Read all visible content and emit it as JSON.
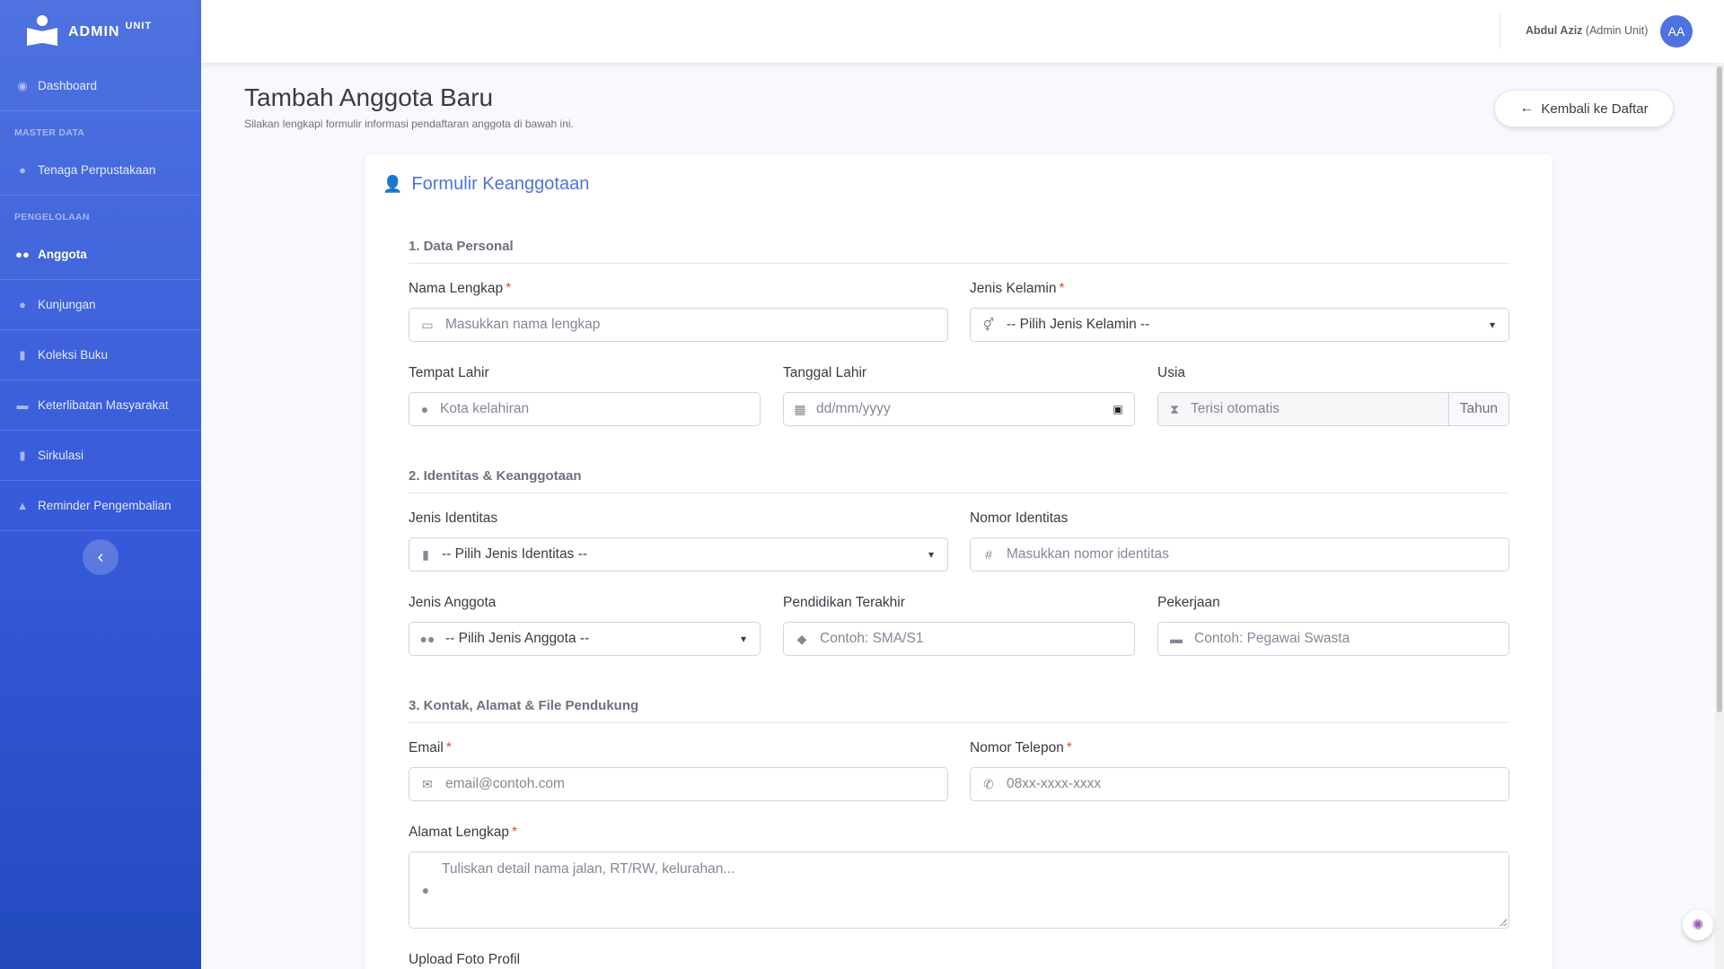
{
  "brand": {
    "name": "ADMIN",
    "suffix": "UNIT"
  },
  "sidebar": {
    "items": [
      {
        "label": "Dashboard",
        "icon": "dashboard-icon"
      },
      {
        "heading": "MASTER DATA"
      },
      {
        "label": "Tenaga Perpustakaan",
        "icon": "user-icon"
      },
      {
        "heading": "PENGELOLAAN"
      },
      {
        "label": "Anggota",
        "icon": "users-icon",
        "active": true
      },
      {
        "label": "Kunjungan",
        "icon": "user-walk-icon"
      },
      {
        "label": "Koleksi Buku",
        "icon": "book-icon"
      },
      {
        "label": "Keterlibatan Masyarakat",
        "icon": "handshake-icon"
      },
      {
        "label": "Sirkulasi",
        "icon": "clipboard-icon"
      },
      {
        "label": "Reminder Pengembalian",
        "icon": "bell-icon"
      }
    ],
    "collapse_icon": "chevron-left-icon"
  },
  "topbar": {
    "user_name": "Abdul Aziz",
    "user_role": "(Admin Unit)",
    "avatar_initials": "AA"
  },
  "header": {
    "title": "Tambah Anggota Baru",
    "subtitle": "Silakan lengkapi formulir informasi pendaftaran anggota di bawah ini.",
    "back_label": "Kembali ke Daftar"
  },
  "form": {
    "title": "Formulir Keanggotaan",
    "sections": {
      "personal": "1. Data Personal",
      "identity": "2. Identitas & Keanggotaan",
      "contact": "3. Kontak, Alamat & File Pendukung"
    },
    "fields": {
      "nama_lengkap": {
        "label": "Nama Lengkap",
        "placeholder": "Masukkan nama lengkap"
      },
      "jenis_kelamin": {
        "label": "Jenis Kelamin",
        "value": "-- Pilih Jenis Kelamin --"
      },
      "tempat_lahir": {
        "label": "Tempat Lahir",
        "placeholder": "Kota kelahiran"
      },
      "tanggal_lahir": {
        "label": "Tanggal Lahir",
        "placeholder": "dd/mm/yyyy"
      },
      "usia": {
        "label": "Usia",
        "placeholder": "Terisi otomatis",
        "suffix": "Tahun"
      },
      "jenis_identitas": {
        "label": "Jenis Identitas",
        "value": "-- Pilih Jenis Identitas --"
      },
      "nomor_identitas": {
        "label": "Nomor Identitas",
        "placeholder": "Masukkan nomor identitas"
      },
      "jenis_anggota": {
        "label": "Jenis Anggota",
        "value": "-- Pilih Jenis Anggota --"
      },
      "pendidikan": {
        "label": "Pendidikan Terakhir",
        "placeholder": "Contoh: SMA/S1"
      },
      "pekerjaan": {
        "label": "Pekerjaan",
        "placeholder": "Contoh: Pegawai Swasta"
      },
      "email": {
        "label": "Email",
        "placeholder": "email@contoh.com"
      },
      "telepon": {
        "label": "Nomor Telepon",
        "placeholder": "08xx-xxxx-xxxx"
      },
      "alamat": {
        "label": "Alamat Lengkap",
        "placeholder": "Tuliskan detail nama jalan, RT/RW, kelurahan..."
      },
      "foto": {
        "label": "Upload Foto Profil"
      }
    }
  },
  "colors": {
    "primary": "#4e73df",
    "required": "#e74a3b"
  }
}
